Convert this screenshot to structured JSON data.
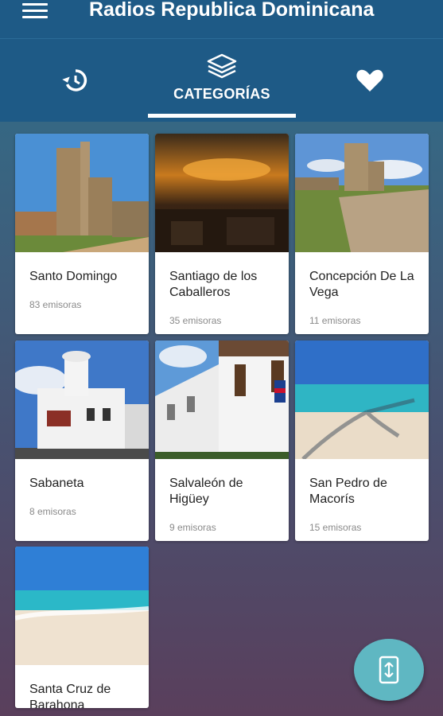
{
  "app_title": "Radios Republica Dominicana",
  "tabs": {
    "history_icon": "history-icon",
    "categories_label": "CATEGORÍAS",
    "favorites_icon": "heart-icon"
  },
  "categories": [
    {
      "name": "Santo Domingo",
      "count": "83 emisoras"
    },
    {
      "name": "Santiago de los Caballeros",
      "count": "35 emisoras"
    },
    {
      "name": "Concepción De La Vega",
      "count": "11 emisoras"
    },
    {
      "name": "Sabaneta",
      "count": "8 emisoras"
    },
    {
      "name": "Salvaleón de Higüey",
      "count": "9 emisoras"
    },
    {
      "name": "San Pedro de Macorís",
      "count": "15 emisoras"
    },
    {
      "name": "Santa Cruz de Barahona",
      "count": ""
    }
  ],
  "colors": {
    "appbar": "#1e5a86",
    "fab": "#5fb7c2"
  },
  "fab_icon": "swap-vertical-icon"
}
